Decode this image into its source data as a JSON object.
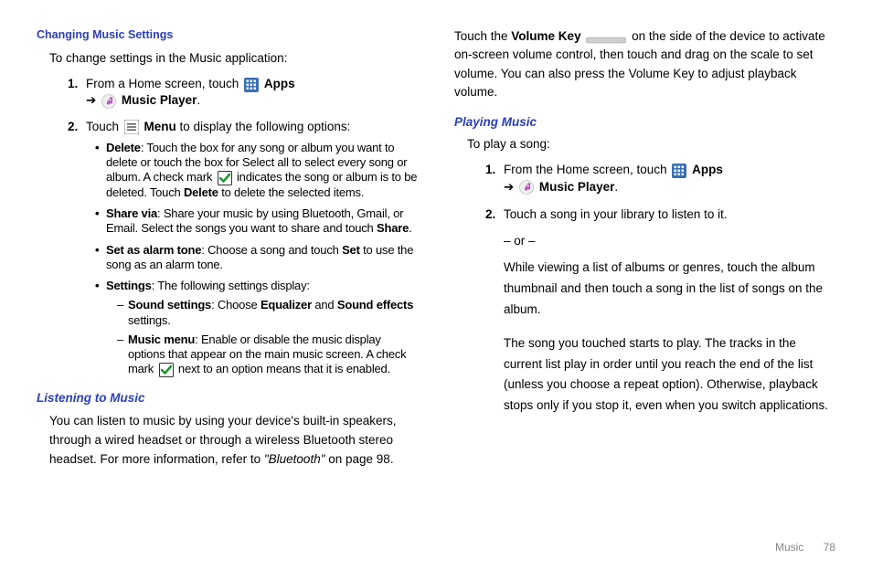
{
  "left": {
    "h1": "Changing Music Settings",
    "intro": "To change settings in the Music application:",
    "step1_a": "From a Home screen, touch ",
    "apps": "Apps",
    "arrow": "➔",
    "music_player": "Music Player",
    "period": ".",
    "step2_a": "Touch ",
    "menu": "Menu",
    "step2_b": " to display the following options:",
    "bul_delete_b": "Delete",
    "bul_delete_t1": ": Touch the box for any song or album you want to delete or touch the box for Select all to select every song or album. A check mark ",
    "bul_delete_t2": " indicates the song or album is to be deleted. Touch ",
    "bul_delete_b2": "Delete",
    "bul_delete_t3": " to delete the selected items.",
    "bul_share_b": "Share via",
    "bul_share_t": ": Share your music by using Bluetooth, Gmail, or Email. Select the songs you want to share and touch ",
    "bul_share_b2": "Share",
    "bul_alarm_b": "Set as alarm tone",
    "bul_alarm_t": ": Choose a song and touch ",
    "bul_alarm_b2": "Set",
    "bul_alarm_t2": " to use the song as an alarm tone.",
    "bul_settings_b": "Settings",
    "bul_settings_t": ": The following settings display:",
    "dash_sound_b": "Sound settings",
    "dash_sound_t": ": Choose ",
    "dash_sound_b2": "Equalizer",
    "dash_sound_and": " and ",
    "dash_sound_b3": "Sound effects",
    "dash_sound_t2": " settings.",
    "dash_music_b": "Music menu",
    "dash_music_t": ": Enable or disable the music display options that appear on the main music screen. A check mark ",
    "dash_music_t2": " next to an option means that it is enabled.",
    "h2": "Listening to Music",
    "listen_p": "You can listen to music by using your device's built-in speakers, through a wired headset or through a wireless Bluetooth stereo headset. For more information, refer to ",
    "listen_ref": "\"Bluetooth\"",
    "listen_p2": " on page 98."
  },
  "right": {
    "top_p": "Touch the ",
    "top_b": "Volume Key",
    "top_p2": " on the side of the device to activate on-screen volume control, then touch and drag on the scale to set volume. You can also press the Volume Key to adjust playback volume.",
    "h1": "Playing Music",
    "intro": "To play a song:",
    "step1_a": "From the Home screen, touch ",
    "apps": "Apps",
    "arrow": "➔",
    "music_player": "Music Player",
    "period": ".",
    "step2_a": "Touch a song in your library to listen to it.",
    "or": "– or –",
    "step2_b": "While viewing a list of albums or genres, touch the album thumbnail and then touch a song in the list of songs on the album.",
    "step2_c": "The song you touched starts to play. The tracks in the current list play in order until you reach the end of the list (unless you choose a repeat option). Otherwise, playback stops only if you stop it, even when you switch applications."
  },
  "footer": {
    "section": "Music",
    "page": "78"
  }
}
